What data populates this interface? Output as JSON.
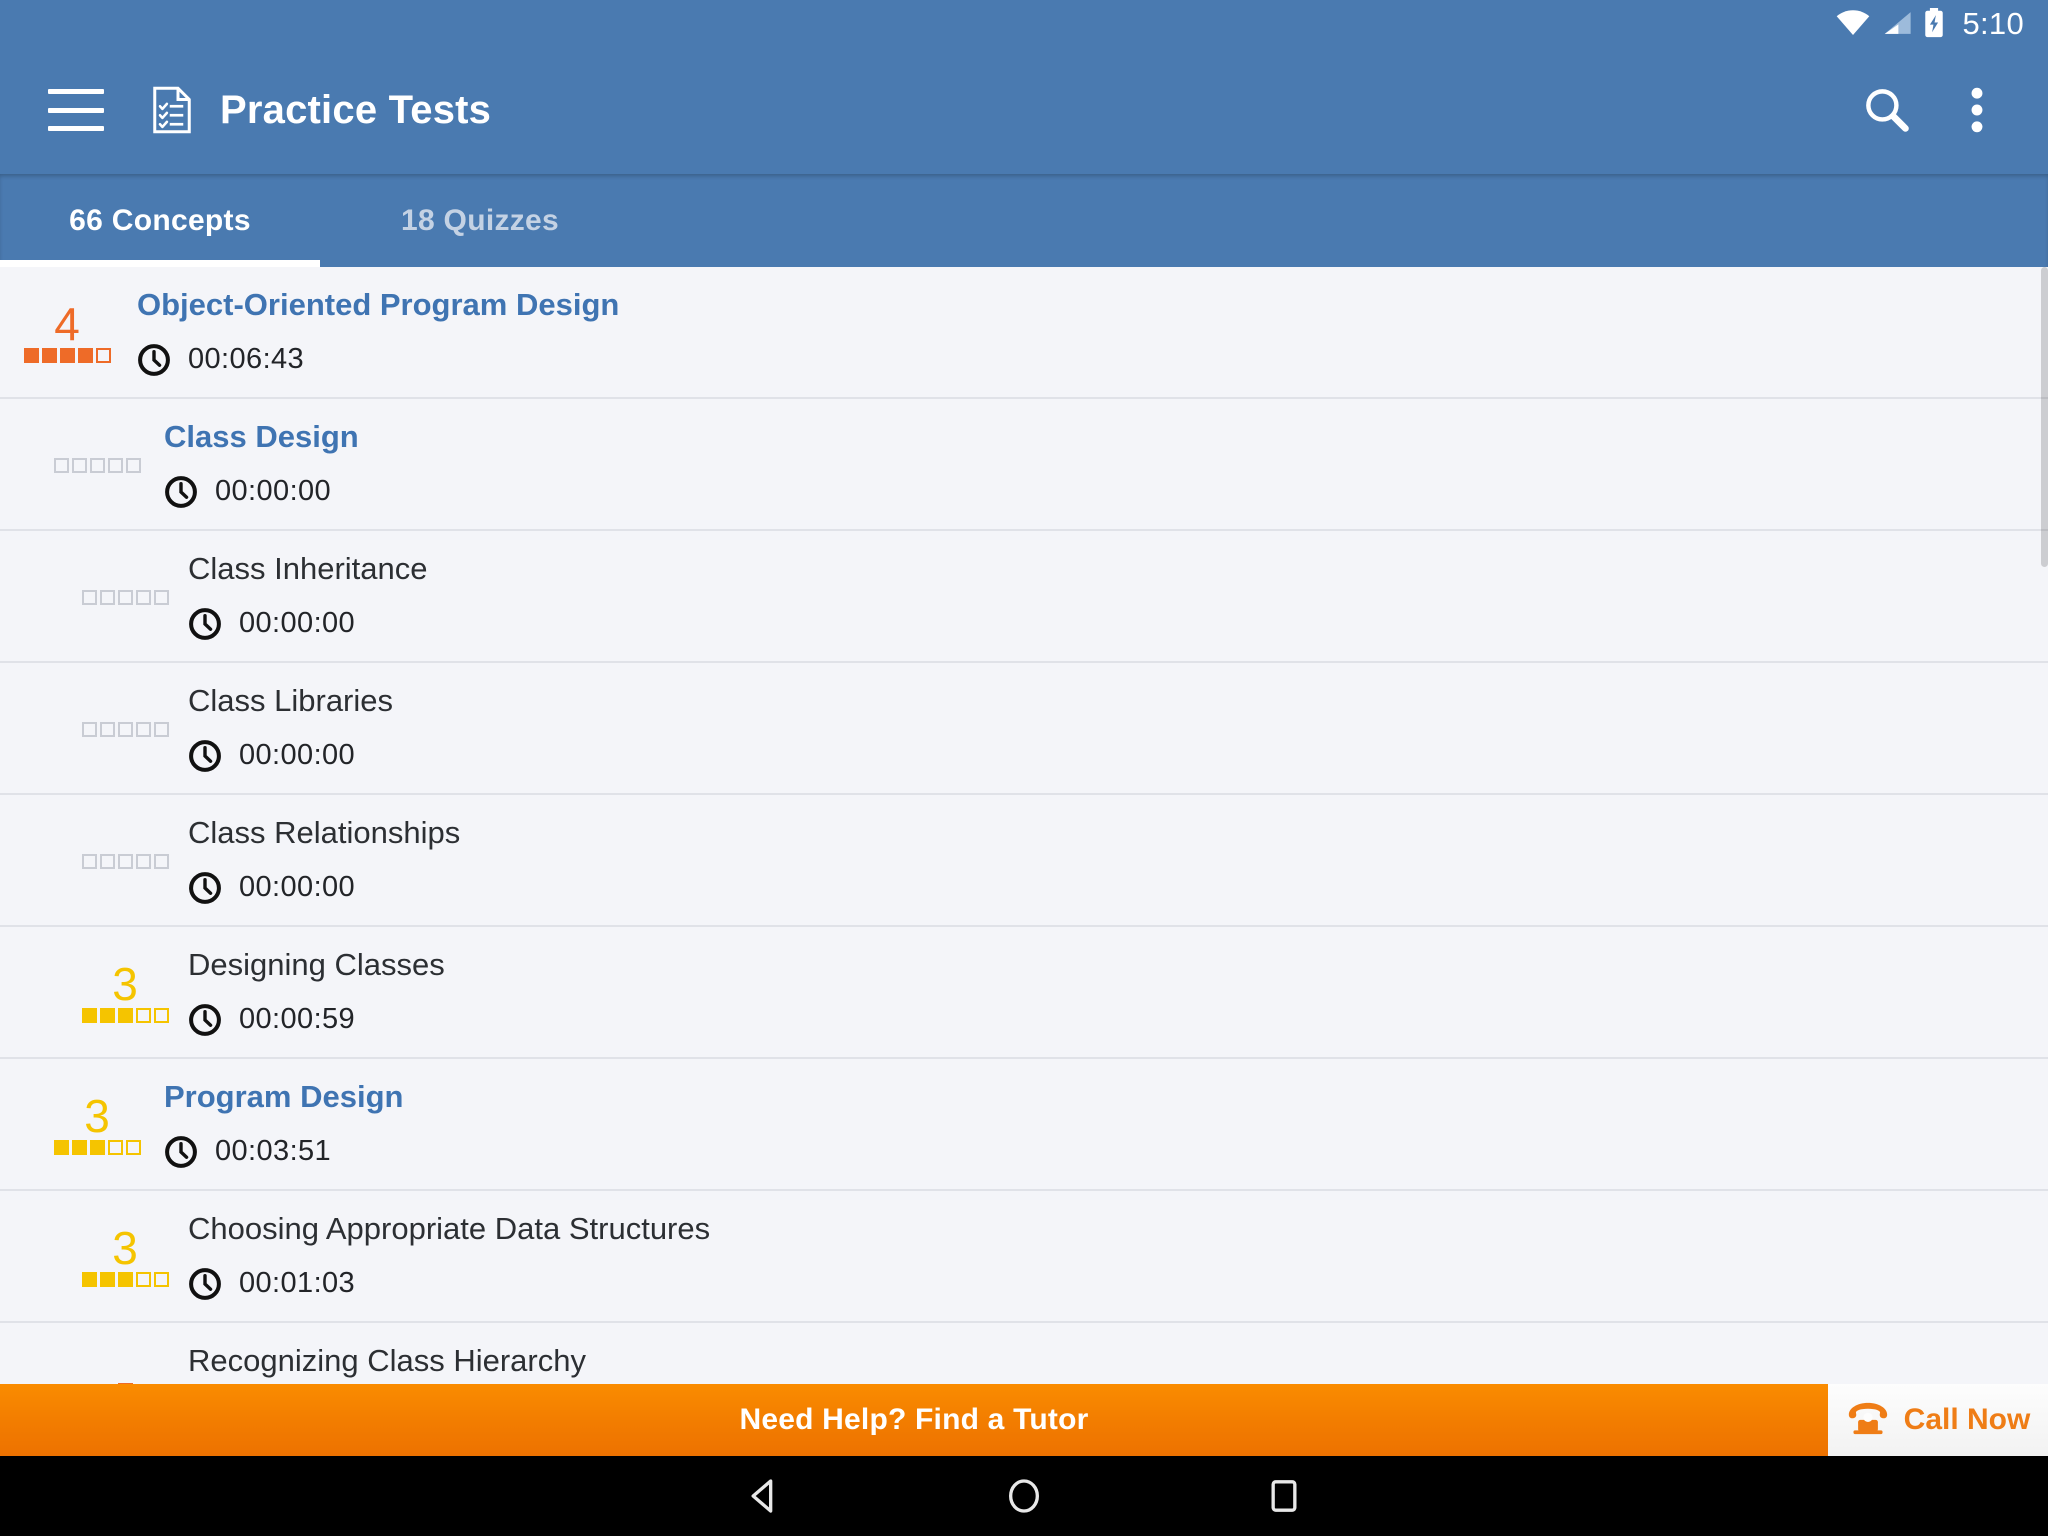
{
  "statusbar": {
    "time": "5:10",
    "icons": [
      "wifi-icon",
      "cell-signal-icon",
      "battery-charging-icon"
    ]
  },
  "appbar": {
    "title": "Practice Tests",
    "menu_icon": "hamburger-menu-icon",
    "app_icon": "checklist-document-icon",
    "search_icon": "search-icon",
    "overflow_icon": "overflow-menu-icon"
  },
  "tabs": [
    {
      "label": "66 Concepts",
      "active": true
    },
    {
      "label": "18 Quizzes",
      "active": false
    }
  ],
  "colors": {
    "primary": "#4a7ab0",
    "link": "#3f74b2",
    "orange": "#ee6b28",
    "yellow": "#f5c400",
    "empty_box": "#c9ccd4",
    "banner_orange": "#f27c00",
    "background": "#f4f5f9"
  },
  "list": [
    {
      "title": "Object-Oriented Program Design",
      "level": 1,
      "rating": "4",
      "filled": 4,
      "total": 5,
      "rating_color": "#ee6b28",
      "time": "00:06:43"
    },
    {
      "title": "Class Design",
      "level": 2,
      "rating": "",
      "filled": 0,
      "total": 5,
      "rating_color": "#c9ccd4",
      "time": "00:00:00"
    },
    {
      "title": "Class Inheritance",
      "level": 3,
      "rating": "",
      "filled": 0,
      "total": 5,
      "rating_color": "#c9ccd4",
      "time": "00:00:00"
    },
    {
      "title": "Class Libraries",
      "level": 3,
      "rating": "",
      "filled": 0,
      "total": 5,
      "rating_color": "#c9ccd4",
      "time": "00:00:00"
    },
    {
      "title": "Class Relationships",
      "level": 3,
      "rating": "",
      "filled": 0,
      "total": 5,
      "rating_color": "#c9ccd4",
      "time": "00:00:00"
    },
    {
      "title": "Designing Classes",
      "level": 3,
      "rating": "3",
      "filled": 3,
      "total": 5,
      "rating_color": "#f5c400",
      "time": "00:00:59"
    },
    {
      "title": "Program Design",
      "level": 2,
      "rating": "3",
      "filled": 3,
      "total": 5,
      "rating_color": "#f5c400",
      "time": "00:03:51"
    },
    {
      "title": "Choosing Appropriate Data Structures",
      "level": 3,
      "rating": "3",
      "filled": 3,
      "total": 5,
      "rating_color": "#f5c400",
      "time": "00:01:03"
    },
    {
      "title": "Recognizing Class Hierarchy",
      "level": 3,
      "rating": "",
      "filled": 0,
      "total": 0,
      "rating_color": "#ee6b28",
      "time": ""
    }
  ],
  "banner": {
    "text": "Need Help? Find a Tutor",
    "cta_label": "Call Now",
    "cta_icon": "phone-icon"
  },
  "navbar": {
    "back": "back-triangle-icon",
    "home": "home-circle-icon",
    "recents": "recents-square-icon"
  }
}
